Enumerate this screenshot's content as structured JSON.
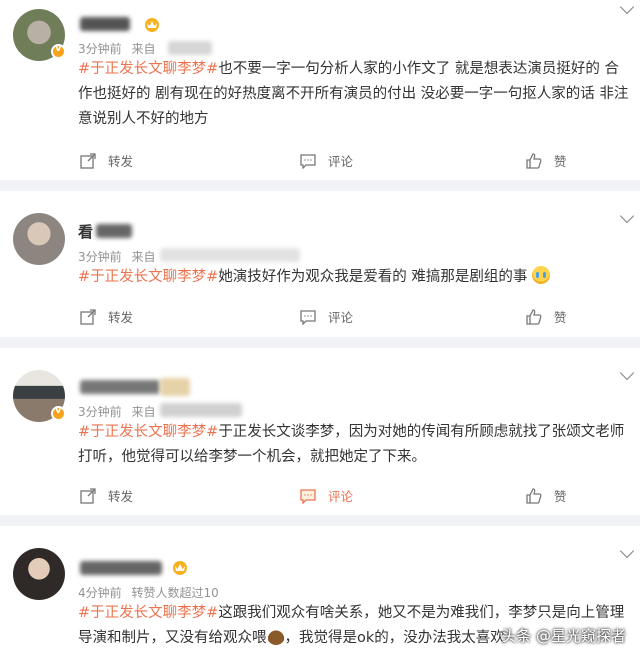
{
  "comments": [
    {
      "name": "",
      "time": "3分钟前",
      "source": "来自",
      "tag": "#于正发长文聊李梦#",
      "body": "也不要一字一句分析人家的小作文了 就是想表达演员挺好的 合作也挺好的 剧有现在的好热度离不开所有演员的付出 没必要一字一句抠人家的话 非注意说别人不好的地方",
      "repost": "转发",
      "comment": "评论",
      "like": "赞"
    },
    {
      "name": "看",
      "time": "3分钟前",
      "source": "来自",
      "tag": "#于正发长文聊李梦#",
      "body": "她演技好作为观众我是爱看的 难搞那是剧组的事",
      "repost": "转发",
      "comment": "评论",
      "like": "赞"
    },
    {
      "name": "",
      "time": "3分钟前",
      "source": "来自",
      "tag": "#于正发长文聊李梦#",
      "body": "于正发长文谈李梦，因为对她的传闻有所顾虑就找了张颂文老师打听，他觉得可以给李梦一个机会，就把她定了下来。",
      "repost": "转发",
      "comment": "评论",
      "like": "赞"
    },
    {
      "name": "",
      "time": "4分钟前",
      "source": "转赞人数超过10",
      "tag": "#于正发长文聊李梦#",
      "body_a": "这跟我们观众有啥关系，她又不是为难我们，李梦只是向上管理导演和制片，又没有给观众喂",
      "body_b": "，我觉得是ok的，没办法我太喜欢",
      "repost": "转发",
      "comment": "评论",
      "like": "赞"
    }
  ],
  "watermark": "头条 @星光窥探者",
  "icons": {
    "repost": "repost-icon",
    "comment": "comment-icon",
    "like": "thumbs-up-icon",
    "crown": "crown-icon",
    "vip": "verified-badge-icon",
    "more": "chevron-down-icon",
    "crying": "crying-emoji-icon",
    "poop": "poop-emoji-icon"
  },
  "colors": {
    "tag": "#eb7350",
    "meta": "#939393",
    "background": "#f1f2f5",
    "badge": "#f7a21a"
  }
}
